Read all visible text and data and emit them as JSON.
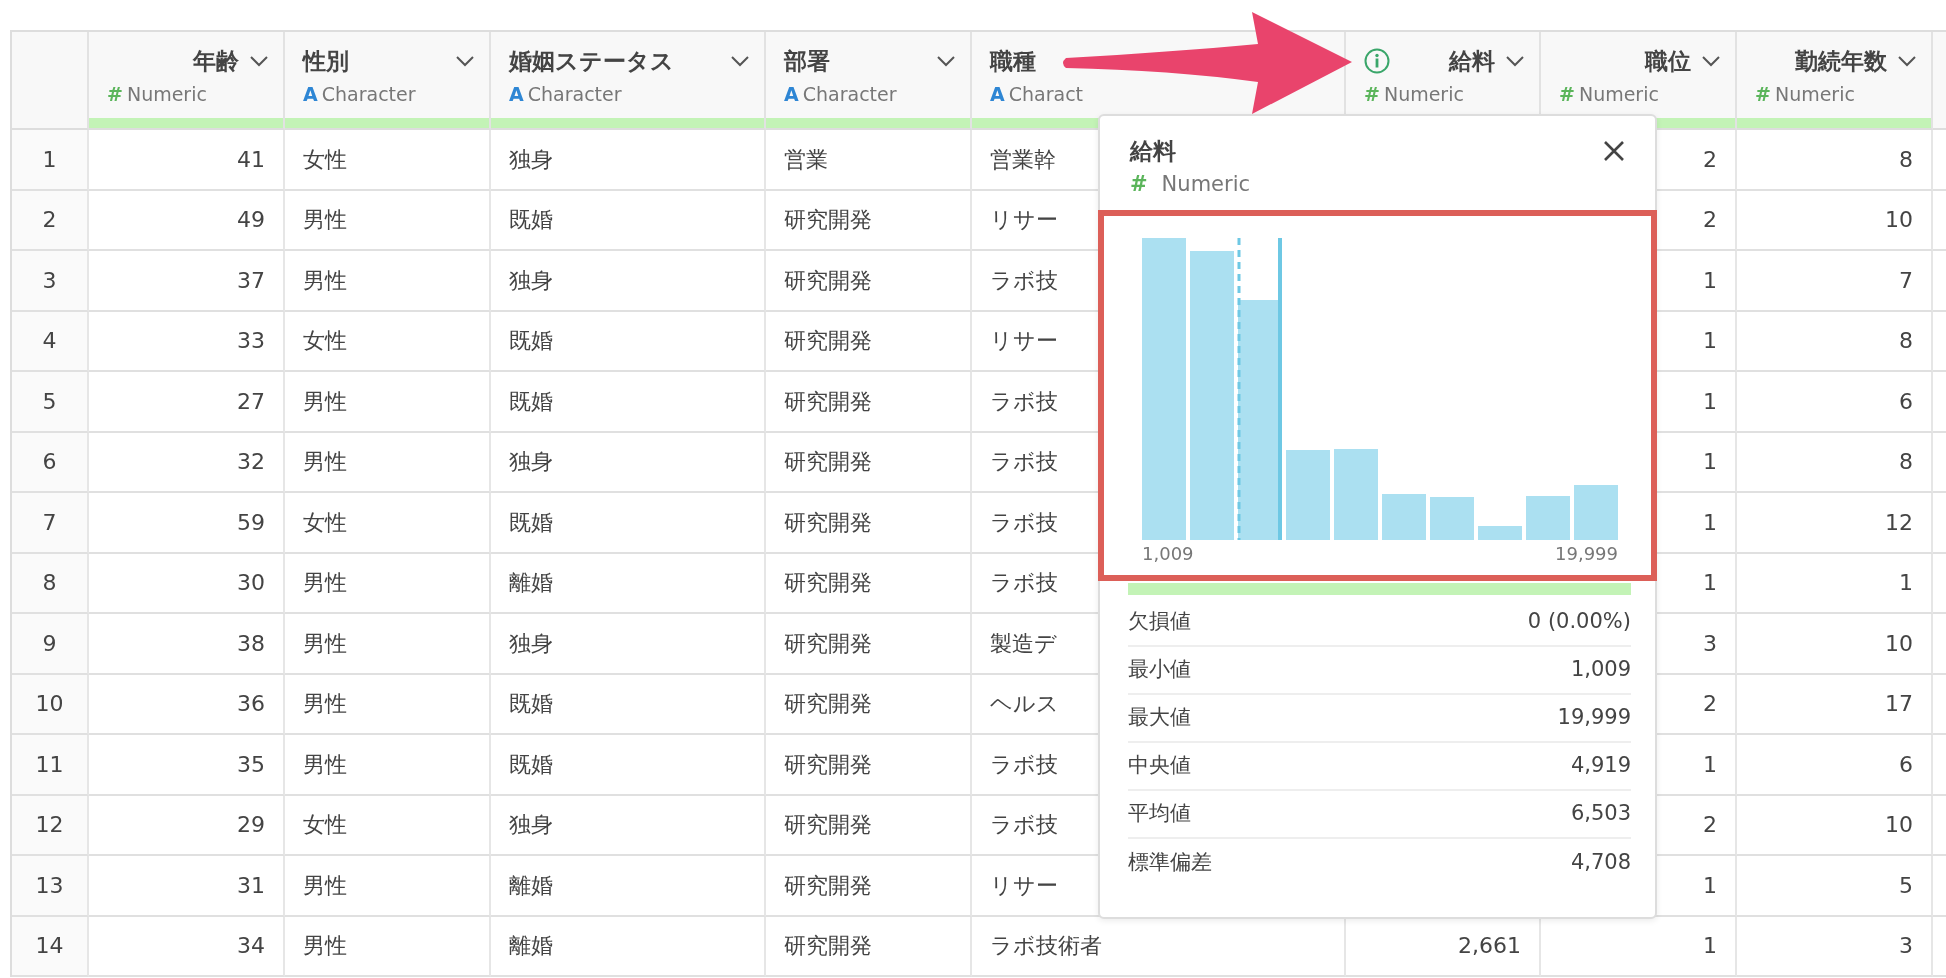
{
  "columns": [
    {
      "name": "年齢",
      "kind": "numeric",
      "type_icon": "#",
      "type_label": "Numeric",
      "info": false
    },
    {
      "name": "性別",
      "kind": "character",
      "type_icon": "A",
      "type_label": "Character",
      "info": false
    },
    {
      "name": "婚姻ステータス",
      "kind": "character",
      "type_icon": "A",
      "type_label": "Character",
      "info": false
    },
    {
      "name": "部署",
      "kind": "character",
      "type_icon": "A",
      "type_label": "Character",
      "info": false
    },
    {
      "name": "職種",
      "kind": "character",
      "type_icon": "A",
      "type_label": "Charact",
      "info": false,
      "menu_hidden": true
    },
    {
      "name": "給料",
      "kind": "numeric",
      "type_icon": "#",
      "type_label": "Numeric",
      "info": true
    },
    {
      "name": "職位",
      "kind": "numeric",
      "type_icon": "#",
      "type_label": "Numeric",
      "info": false
    },
    {
      "name": "勤続年数",
      "kind": "numeric",
      "type_icon": "#",
      "type_label": "Numeric",
      "info": false
    }
  ],
  "rows": [
    {
      "no": "1",
      "cells": [
        "41",
        "女性",
        "独身",
        "営業",
        "営業幹",
        null,
        "2",
        "8"
      ]
    },
    {
      "no": "2",
      "cells": [
        "49",
        "男性",
        "既婚",
        "研究開発",
        "リサー",
        null,
        "2",
        "10"
      ]
    },
    {
      "no": "3",
      "cells": [
        "37",
        "男性",
        "独身",
        "研究開発",
        "ラボ技",
        null,
        "1",
        "7"
      ]
    },
    {
      "no": "4",
      "cells": [
        "33",
        "女性",
        "既婚",
        "研究開発",
        "リサー",
        null,
        "1",
        "8"
      ]
    },
    {
      "no": "5",
      "cells": [
        "27",
        "男性",
        "既婚",
        "研究開発",
        "ラボ技",
        null,
        "1",
        "6"
      ]
    },
    {
      "no": "6",
      "cells": [
        "32",
        "男性",
        "独身",
        "研究開発",
        "ラボ技",
        null,
        "1",
        "8"
      ]
    },
    {
      "no": "7",
      "cells": [
        "59",
        "女性",
        "既婚",
        "研究開発",
        "ラボ技",
        null,
        "1",
        "12"
      ]
    },
    {
      "no": "8",
      "cells": [
        "30",
        "男性",
        "離婚",
        "研究開発",
        "ラボ技",
        null,
        "1",
        "1"
      ]
    },
    {
      "no": "9",
      "cells": [
        "38",
        "男性",
        "独身",
        "研究開発",
        "製造デ",
        null,
        "3",
        "10"
      ]
    },
    {
      "no": "10",
      "cells": [
        "36",
        "男性",
        "既婚",
        "研究開発",
        "ヘルス",
        null,
        "2",
        "17"
      ]
    },
    {
      "no": "11",
      "cells": [
        "35",
        "男性",
        "既婚",
        "研究開発",
        "ラボ技",
        null,
        "1",
        "6"
      ]
    },
    {
      "no": "12",
      "cells": [
        "29",
        "女性",
        "独身",
        "研究開発",
        "ラボ技",
        null,
        "2",
        "10"
      ]
    },
    {
      "no": "13",
      "cells": [
        "31",
        "男性",
        "離婚",
        "研究開発",
        "リサー",
        null,
        "1",
        "5"
      ]
    },
    {
      "no": "14",
      "cells": [
        "34",
        "男性",
        "離婚",
        "研究開発",
        "ラボ技術者",
        "2,661",
        "1",
        "3"
      ]
    }
  ],
  "popup": {
    "title": "給料",
    "kind": "numeric",
    "type_icon": "#",
    "type_label": "Numeric",
    "histogram": {
      "min_label": "1,009",
      "max_label": "19,999"
    },
    "stats": [
      {
        "label": "欠損値",
        "value": "0 (0.00%)"
      },
      {
        "label": "最小値",
        "value": "1,009"
      },
      {
        "label": "最大値",
        "value": "19,999"
      },
      {
        "label": "中央値",
        "value": "4,919"
      },
      {
        "label": "平均値",
        "value": "6,503"
      },
      {
        "label": "標準偏差",
        "value": "4,708"
      }
    ]
  }
}
